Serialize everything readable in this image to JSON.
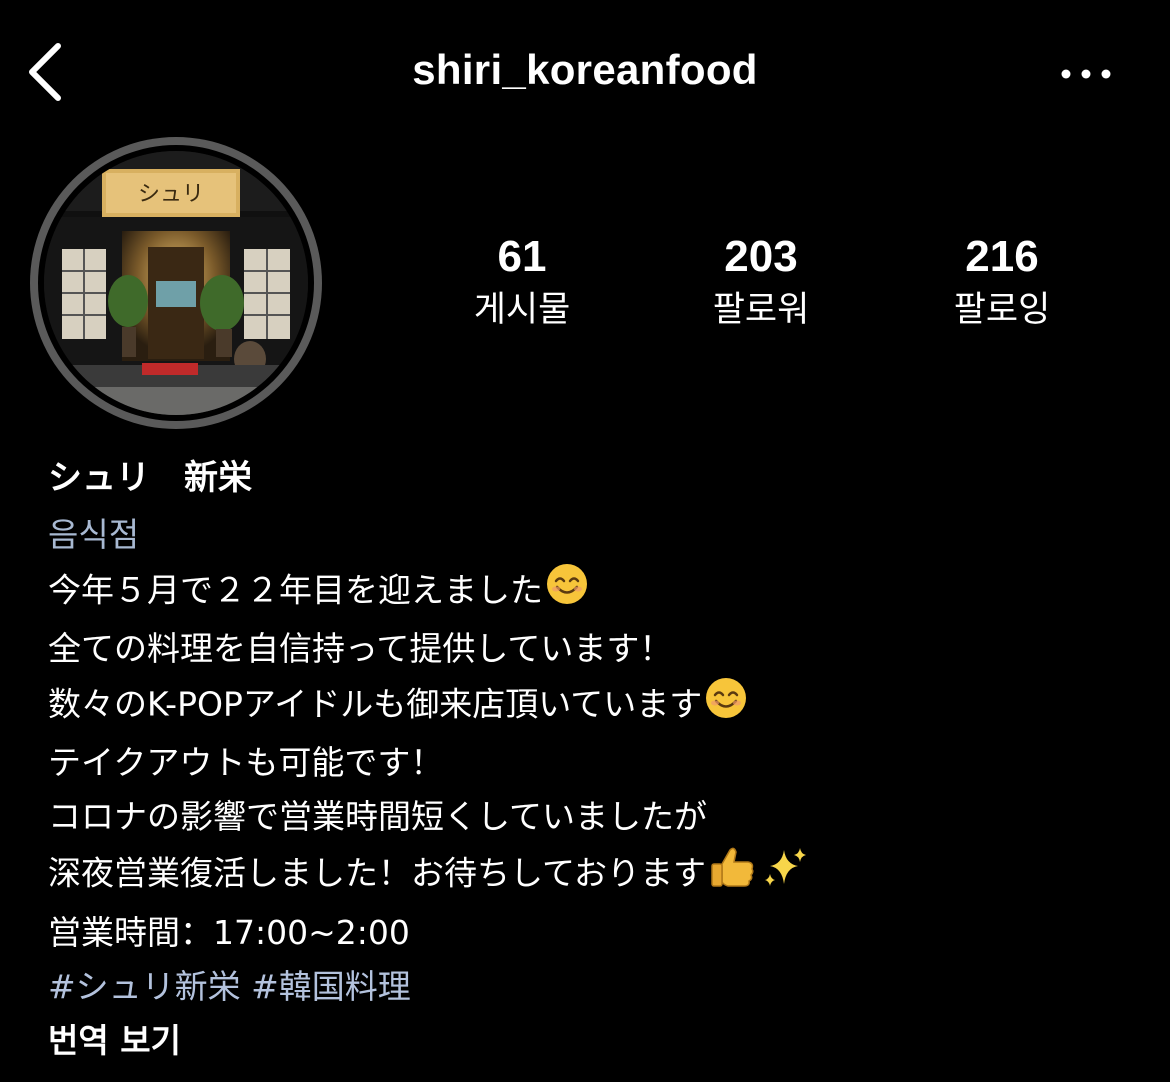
{
  "header": {
    "username": "shiri_koreanfood",
    "back_icon": "chevron-left-icon",
    "more_icon": "ellipsis-icon"
  },
  "profile": {
    "avatar_sign_text": "シュリ",
    "stats": [
      {
        "value": "61",
        "label": "게시물"
      },
      {
        "value": "203",
        "label": "팔로워"
      },
      {
        "value": "216",
        "label": "팔로잉"
      }
    ]
  },
  "bio": {
    "name": "シュリ　新栄",
    "category": "음식점",
    "lines": [
      "今年５月で２２年目を迎えました",
      "全ての料理を自信持って提供しています！",
      "数々のK-POPアイドルも御来店頂いています",
      "テイクアウトも可能です！",
      "コロナの影響で営業時間短くしていましたが",
      "深夜営業復活しました！お待ちしております",
      "営業時間：17:00~2:00"
    ],
    "hashtags": [
      "#シュリ新栄",
      "#韓国料理"
    ],
    "translate_label": "번역 보기"
  },
  "colors": {
    "background": "#000000",
    "text": "#ffffff",
    "category": "#a8b9d2",
    "hashtag": "#b3c2dd",
    "avatar_ring": "#5a5a5a"
  }
}
